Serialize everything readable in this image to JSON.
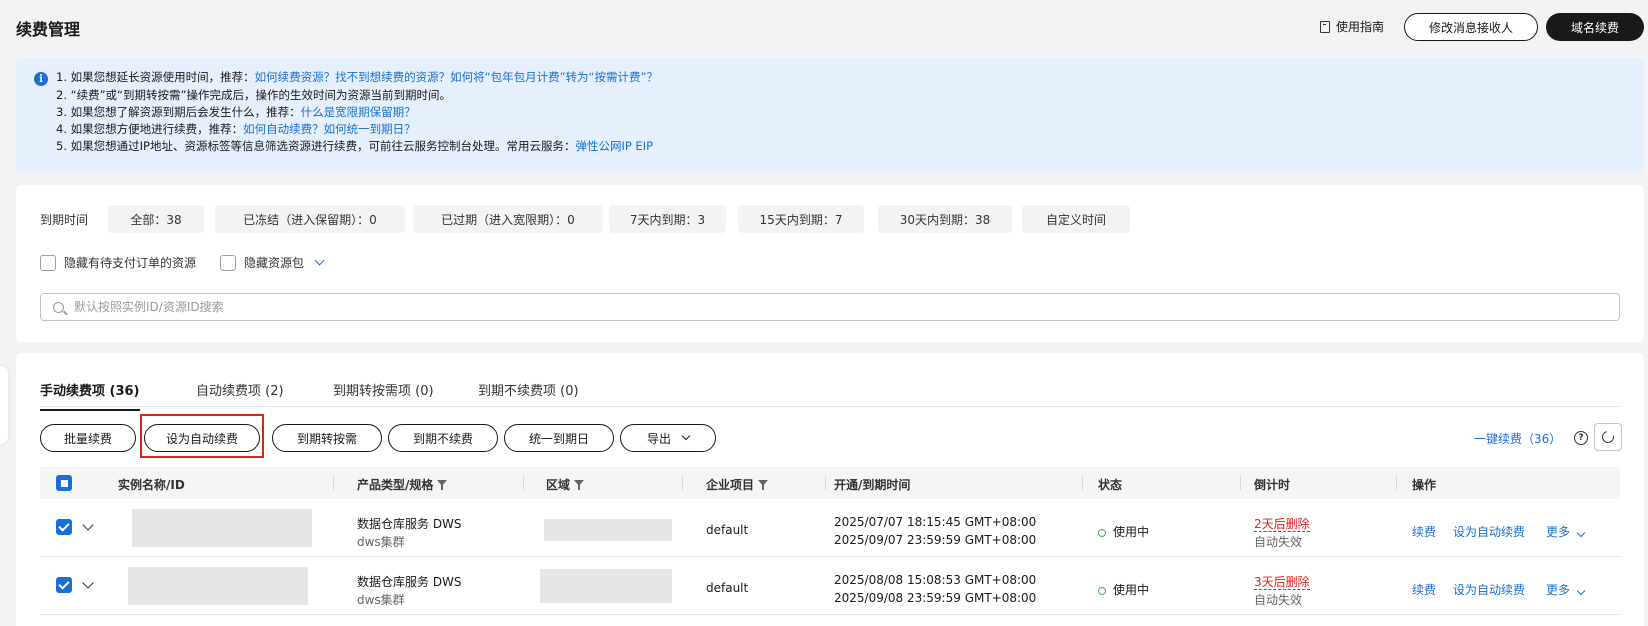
{
  "header": {
    "title": "续费管理",
    "guide": "使用指南",
    "modify_receiver": "修改消息接收人",
    "domain_renew": "域名续费"
  },
  "info": {
    "line1_prefix": "1. 如果您想延长资源使用时间，推荐：",
    "line1_link": "如何续费资源？找不到想续费的资源？如何将“包年包月计费”转为“按需计费”？",
    "line2": "2. “续费”或“到期转按需”操作完成后，操作的生效时间为资源当前到期时间。",
    "line3_prefix": "3. 如果您想了解资源到期后会发生什么，推荐：",
    "line3_link": "什么是宽限期保留期？",
    "line4_prefix": "4. 如果您想方便地进行续费，推荐：",
    "line4_link": "如何自动续费？如何统一到期日？",
    "line5_prefix": "5. 如果您想通过IP地址、资源标签等信息筛选资源进行续费，可前往云服务控制台处理。常用云服务：",
    "line5_link": "弹性公网IP EIP"
  },
  "filters": {
    "label": "到期时间",
    "chips": [
      "全部：38",
      "已冻结（进入保留期）：0",
      "已过期（进入宽限期）：0",
      "7天内到期：3",
      "15天内到期：7",
      "30天内到期：38",
      "自定义时间"
    ],
    "hide_pending": "隐藏有待支付订单的资源",
    "hide_package": "隐藏资源包",
    "search_placeholder": "默认按照实例ID/资源ID搜索"
  },
  "tabs": [
    "手动续费项 (36)",
    "自动续费项 (2)",
    "到期转按需项 (0)",
    "到期不续费项 (0)"
  ],
  "actions": {
    "batch_renew": "批量续费",
    "set_auto": "设为自动续费",
    "to_ondemand": "到期转按需",
    "no_renew": "到期不续费",
    "unify_date": "统一到期日",
    "export": "导出",
    "one_click": "一键续费（36）"
  },
  "table": {
    "headers": [
      "实例名称/ID",
      "产品类型/规格",
      "区域",
      "企业项目",
      "开通/到期时间",
      "状态",
      "倒计时",
      "操作"
    ],
    "rows": [
      {
        "product": "数据仓库服务 DWS",
        "spec": "dws集群",
        "project": "default",
        "start": "2025/07/07 18:15:45 GMT+08:00",
        "end": "2025/09/07 23:59:59 GMT+08:00",
        "status": "使用中",
        "countdown": "2天后删除",
        "countdown_sub": "自动失效",
        "op_renew": "续费",
        "op_auto": "设为自动续费",
        "op_more": "更多"
      },
      {
        "product": "数据仓库服务 DWS",
        "spec": "dws集群",
        "project": "default",
        "start": "2025/08/08 15:08:53 GMT+08:00",
        "end": "2025/09/08 23:59:59 GMT+08:00",
        "status": "使用中",
        "countdown": "3天后删除",
        "countdown_sub": "自动失效",
        "op_renew": "续费",
        "op_auto": "设为自动续费",
        "op_more": "更多"
      }
    ]
  },
  "colors": {
    "primary_link": "#1a6fd6",
    "danger": "#e0201c",
    "status_ok": "#4caf50",
    "info_bg": "#e5f0fc"
  }
}
